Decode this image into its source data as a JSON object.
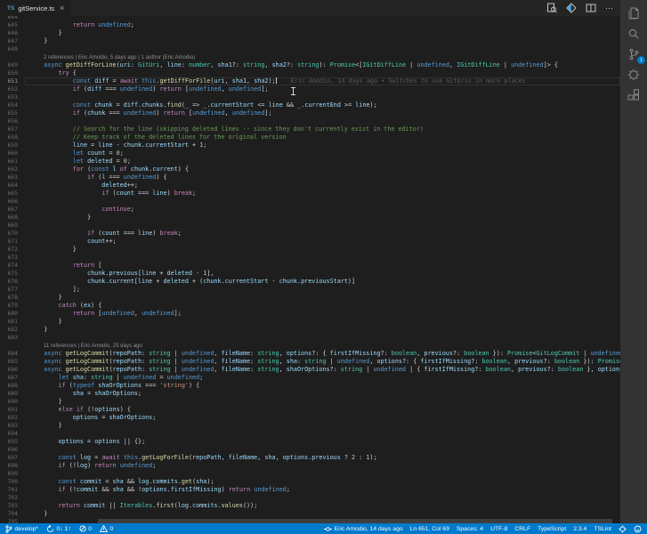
{
  "tab_bar": {
    "active_tab": {
      "file_type_icon": "TS",
      "label": "gitService.ts",
      "close_icon": "×"
    },
    "actions": [
      {
        "name": "toggle-blame"
      },
      {
        "name": "open-changes"
      },
      {
        "name": "split-editor"
      },
      {
        "name": "more-actions",
        "glyph": "⋯"
      }
    ]
  },
  "editor": {
    "current_line": 651,
    "blame_annotation": "Eric Amodio, 14 days ago • Switches to use GitUris in more places",
    "lines": [
      {
        "n": 644,
        "t": ""
      },
      {
        "n": 645,
        "t": "            return undefined;"
      },
      {
        "n": 646,
        "t": "        }"
      },
      {
        "n": 647,
        "t": "    }"
      },
      {
        "n": 648,
        "t": ""
      },
      {
        "lens": "2 references | Eric Amodio, 5 days ago | 1 author (Eric Amodio)"
      },
      {
        "n": 649,
        "t": "    async getDiffForLine(uri: GitUri, line: number, sha1?: string, sha2?: string): Promise<[IGitDiffLine | undefined, IGitDiffLine | undefined]> {"
      },
      {
        "n": 650,
        "t": "        try {"
      },
      {
        "n": 651,
        "t": "            const diff = await this.getDiffForFile(uri, sha1, sha2);",
        "current": true,
        "cursor": true,
        "blame": "Eric Amodio, 14 days ago • Switches to use GitUris in more places"
      },
      {
        "n": 652,
        "t": "            if (diff === undefined) return [undefined, undefined];"
      },
      {
        "n": 653,
        "t": ""
      },
      {
        "n": 654,
        "t": "            const chunk = diff.chunks.find(_ => _.currentStart <= line && _.currentEnd >= line);"
      },
      {
        "n": 655,
        "t": "            if (chunk === undefined) return [undefined, undefined];"
      },
      {
        "n": 656,
        "t": ""
      },
      {
        "n": 657,
        "t": "            // Search for the line (skipping deleted lines -- since they don't currently exist in the editor)"
      },
      {
        "n": 658,
        "t": "            // Keep track of the deleted lines for the original version"
      },
      {
        "n": 659,
        "t": "            line = line - chunk.currentStart + 1;"
      },
      {
        "n": 660,
        "t": "            let count = 0;"
      },
      {
        "n": 661,
        "t": "            let deleted = 0;"
      },
      {
        "n": 662,
        "t": "            for (const l of chunk.current) {"
      },
      {
        "n": 663,
        "t": "                if (l === undefined) {"
      },
      {
        "n": 664,
        "t": "                    deleted++;"
      },
      {
        "n": 665,
        "t": "                    if (count === line) break;"
      },
      {
        "n": 666,
        "t": ""
      },
      {
        "n": 667,
        "t": "                    continue;"
      },
      {
        "n": 668,
        "t": "                }"
      },
      {
        "n": 669,
        "t": ""
      },
      {
        "n": 670,
        "t": "                if (count === line) break;"
      },
      {
        "n": 671,
        "t": "                count++;"
      },
      {
        "n": 672,
        "t": "            }"
      },
      {
        "n": 673,
        "t": ""
      },
      {
        "n": 674,
        "t": "            return ["
      },
      {
        "n": 675,
        "t": "                chunk.previous[line + deleted - 1],"
      },
      {
        "n": 676,
        "t": "                chunk.current[line + deleted + (chunk.currentStart - chunk.previousStart)]"
      },
      {
        "n": 677,
        "t": "            ];"
      },
      {
        "n": 678,
        "t": "        }"
      },
      {
        "n": 679,
        "t": "        catch (ex) {"
      },
      {
        "n": 680,
        "t": "            return [undefined, undefined];"
      },
      {
        "n": 681,
        "t": "        }"
      },
      {
        "n": 682,
        "t": "    }"
      },
      {
        "n": 683,
        "t": ""
      },
      {
        "lens": "11 references | Eric Amodio, 25 days ago"
      },
      {
        "n": 684,
        "t": "    async getLogCommit(repoPath: string | undefined, fileName: string, options?: { firstIfMissing?: boolean, previous?: boolean }): Promise<GitLogCommit | undefined>;"
      },
      {
        "n": 685,
        "t": "    async getLogCommit(repoPath: string | undefined, fileName: string, sha: string | undefined, options?: { firstIfMissing?: boolean, previous?: boolean }): Promise<GitLogCommit | undefined>;"
      },
      {
        "n": 686,
        "t": "    async getLogCommit(repoPath: string | undefined, fileName: string, shaOrOptions?: string | undefined | { firstIfMissing?: boolean, previous?: boolean }, options?: { firstIfMissing?: boolean, previous?: boolean }): Promise<GitLogCommit | undefined> {"
      },
      {
        "n": 687,
        "t": "        let sha: string | undefined = undefined;"
      },
      {
        "n": 688,
        "t": "        if (typeof shaOrOptions === 'string') {"
      },
      {
        "n": 689,
        "t": "            sha = shaOrOptions;"
      },
      {
        "n": 690,
        "t": "        }"
      },
      {
        "n": 691,
        "t": "        else if (!options) {"
      },
      {
        "n": 692,
        "t": "            options = shaOrOptions;"
      },
      {
        "n": 693,
        "t": "        }"
      },
      {
        "n": 694,
        "t": ""
      },
      {
        "n": 695,
        "t": "        options = options || {};"
      },
      {
        "n": 696,
        "t": ""
      },
      {
        "n": 697,
        "t": "        const log = await this.getLogForFile(repoPath, fileName, sha, options.previous ? 2 : 1);"
      },
      {
        "n": 698,
        "t": "        if (!log) return undefined;"
      },
      {
        "n": 699,
        "t": ""
      },
      {
        "n": 700,
        "t": "        const commit = sha && log.commits.get(sha);"
      },
      {
        "n": 701,
        "t": "        if (!commit && sha && !options.firstIfMissing) return undefined;"
      },
      {
        "n": 702,
        "t": ""
      },
      {
        "n": 703,
        "t": "        return commit || Iterables.first(log.commits.values());"
      },
      {
        "n": 704,
        "t": "    }"
      },
      {
        "n": 705,
        "t": ""
      }
    ]
  },
  "activity_bar": {
    "items": [
      {
        "name": "explorer"
      },
      {
        "name": "search"
      },
      {
        "name": "source-control",
        "badge": "1"
      },
      {
        "name": "debug"
      },
      {
        "name": "extensions"
      }
    ]
  },
  "status_bar": {
    "left": [
      {
        "icon": "git-branch",
        "label": "develop*"
      },
      {
        "icon": "sync",
        "label": "0↓ 1↑"
      },
      {
        "icon": "error",
        "label": "0"
      },
      {
        "icon": "warning",
        "label": "0"
      }
    ],
    "right": [
      {
        "icon": "commit",
        "label": "Eric Amodio, 14 days ago"
      },
      {
        "label": "Ln 651, Col 69"
      },
      {
        "label": "Spaces: 4"
      },
      {
        "label": "UTF-8"
      },
      {
        "label": "CRLF"
      },
      {
        "label": "TypeScript"
      },
      {
        "label": "2.3.4"
      },
      {
        "label": "TSLint"
      },
      {
        "icon": "gear"
      },
      {
        "icon": "smiley"
      }
    ]
  },
  "colors": {
    "status_bar": "#007acc",
    "activity_bar": "#333333",
    "editor_background": "#1e1e1e",
    "tab_bar": "#252526",
    "badge": "#007acc",
    "ts_icon": "#519aba",
    "tokens": {
      "keyword": "#569CD6",
      "control": "#C586C0",
      "type": "#4EC9B0",
      "function": "#DCDCAA",
      "variable": "#9CDCFE",
      "string": "#CE9178",
      "number": "#B5CEA8",
      "comment": "#6A9955",
      "blame": "#5a5a5a",
      "codelens": "#8f8f8f",
      "line_number": "#6b6b6b"
    }
  }
}
